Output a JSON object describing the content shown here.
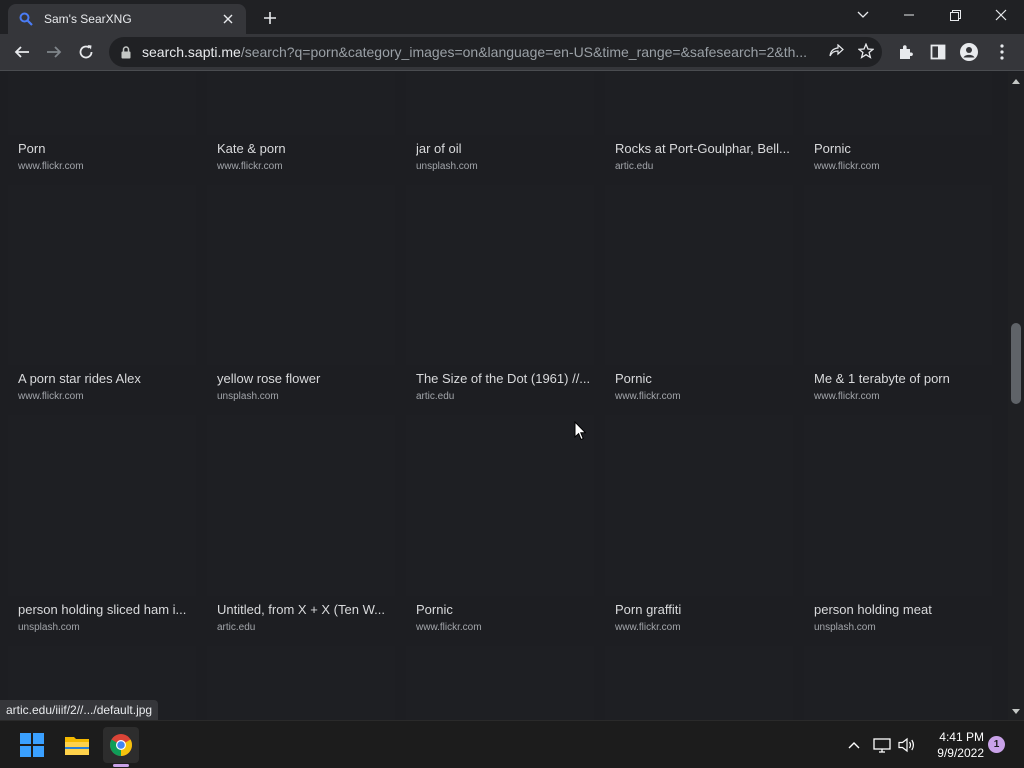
{
  "browser": {
    "tab_title": "Sam's SearXNG",
    "url_host": "search.sapti.me",
    "url_rest": "/search?q=porn&category_images=on&language=en-US&time_range=&safesearch=2&th...",
    "status_url": "artic.edu/iiif/2//.../default.jpg"
  },
  "results": [
    {
      "title": "Porn",
      "source": "www.flickr.com"
    },
    {
      "title": "Kate & porn",
      "source": "www.flickr.com"
    },
    {
      "title": "jar of oil",
      "source": "unsplash.com"
    },
    {
      "title": "Rocks at Port-Goulphar, Bell...",
      "source": "artic.edu"
    },
    {
      "title": "Pornic",
      "source": "www.flickr.com"
    },
    {
      "title": "A porn star rides Alex",
      "source": "www.flickr.com"
    },
    {
      "title": "yellow rose flower",
      "source": "unsplash.com"
    },
    {
      "title": "The Size of the Dot (1961) //...",
      "source": "artic.edu"
    },
    {
      "title": "Pornic",
      "source": "www.flickr.com"
    },
    {
      "title": "Me & 1 terabyte of porn",
      "source": "www.flickr.com"
    },
    {
      "title": "person holding sliced ham i...",
      "source": "unsplash.com"
    },
    {
      "title": "Untitled, from X + X (Ten W...",
      "source": "artic.edu"
    },
    {
      "title": "Pornic",
      "source": "www.flickr.com"
    },
    {
      "title": "Porn graffiti",
      "source": "www.flickr.com"
    },
    {
      "title": "person holding meat",
      "source": "unsplash.com"
    }
  ],
  "taskbar": {
    "time": "4:41 PM",
    "date": "9/9/2022",
    "notification_count": "1"
  },
  "colors": {
    "chrome_dark": "#202124",
    "toolbar": "#35363a",
    "page_bg": "#1d1e22",
    "accent": "#c9a2e8"
  }
}
